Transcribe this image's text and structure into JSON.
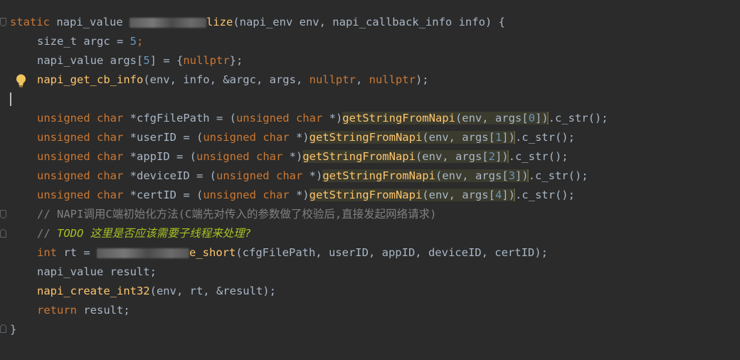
{
  "code": {
    "line1": {
      "kw": "static",
      "type": " napi_value ",
      "fn_tail": "lize",
      "params": "(napi_env env, napi_callback_info info) {"
    },
    "line2": {
      "text": "size_t argc = ",
      "num": "5",
      "end": ";"
    },
    "line3": {
      "text": "napi_value args[",
      "num": "5",
      "mid": "] = {",
      "kw": "nullptr",
      "end": "};"
    },
    "line4": {
      "fn": "napi_get_cb_info",
      "args": "(env, info, &argc, args, ",
      "kw1": "nullptr",
      "sep": ", ",
      "kw2": "nullptr",
      "end": ");"
    },
    "decls": [
      {
        "kw1": "unsigned",
        "kw2": "char",
        "name": " *cfgFilePath = (",
        "c1": "unsigned",
        "c2": "char",
        "cast_end": " *)",
        "fn": "getStringFromNapi",
        "call": "(env, args[",
        "idx": "0",
        "call_end": "])",
        "tail": ".c_str();"
      },
      {
        "kw1": "unsigned",
        "kw2": "char",
        "name": " *userID = (",
        "c1": "unsigned",
        "c2": "char",
        "cast_end": " *)",
        "fn": "getStringFromNapi",
        "call": "(env, args[",
        "idx": "1",
        "call_end": "])",
        "tail": ".c_str();"
      },
      {
        "kw1": "unsigned",
        "kw2": "char",
        "name": " *appID = (",
        "c1": "unsigned",
        "c2": "char",
        "cast_end": " *)",
        "fn": "getStringFromNapi",
        "call": "(env, args[",
        "idx": "2",
        "call_end": "])",
        "tail": ".c_str();"
      },
      {
        "kw1": "unsigned",
        "kw2": "char",
        "name": " *deviceID = (",
        "c1": "unsigned",
        "c2": "char",
        "cast_end": " *)",
        "fn": "getStringFromNapi",
        "call": "(env, args[",
        "idx": "3",
        "call_end": "])",
        "tail": ".c_str();"
      },
      {
        "kw1": "unsigned",
        "kw2": "char",
        "name": " *certID = (",
        "c1": "unsigned",
        "c2": "char",
        "cast_end": " *)",
        "fn": "getStringFromNapi",
        "call": "(env, args[",
        "idx": "4",
        "call_end": "])",
        "tail": ".c_str();"
      }
    ],
    "comment1": "// NAPI调用C端初始化方法(C端先对传入的参数做了校验后,直接发起网络请求)",
    "comment2_prefix": "// ",
    "comment2_todo": "TODO 这里是否应该需要子线程来处理?",
    "line_rt": {
      "kw": "int",
      "var": " rt = ",
      "fn_tail": "e_short",
      "args": "(cfgFilePath, userID, appID, deviceID, certID);"
    },
    "line_result": "napi_value result;",
    "line_create": {
      "fn": "napi_create_int32",
      "args": "(env, rt, &result);"
    },
    "line_return": {
      "kw": "return",
      "rest": " result;"
    },
    "closing": "}"
  },
  "colors": {
    "background": "#2b2b2b",
    "keyword": "#cc7832",
    "number": "#6897bb",
    "function": "#ffc66d",
    "comment": "#808080",
    "todo": "#a8c023",
    "text": "#a9b7c6"
  },
  "icons": [
    "fold-marker-icon",
    "intention-bulb-icon"
  ]
}
